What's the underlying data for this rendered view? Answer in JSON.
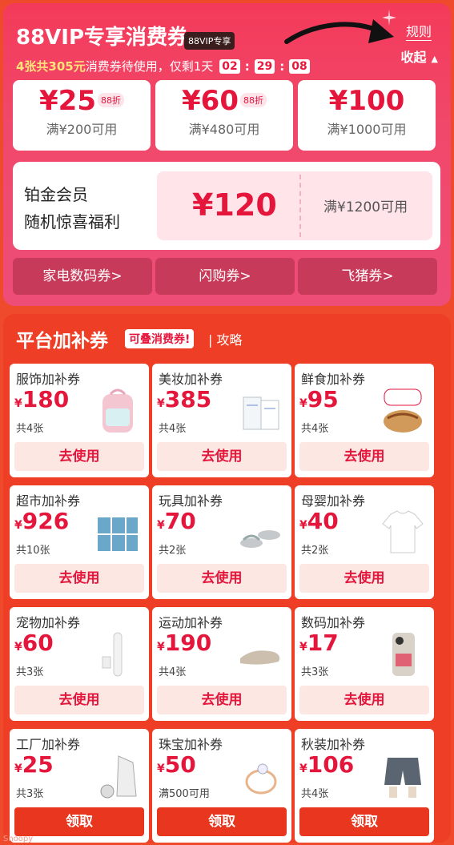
{
  "vip": {
    "title": "88VIP专享消费券",
    "badge": "88VIP专享",
    "rules": "规则",
    "collapse": "收起",
    "countdown_prefix": "4张共305元",
    "countdown_text": "消费券待使用，仅剩1天",
    "timer": [
      "02",
      "29",
      "08"
    ],
    "coupons": [
      {
        "amount": "¥25",
        "discount": "88折",
        "condition": "满¥200可用"
      },
      {
        "amount": "¥60",
        "discount": "88折",
        "condition": "满¥480可用"
      },
      {
        "amount": "¥100",
        "discount": "",
        "condition": "满¥1000可用"
      }
    ],
    "platinum": {
      "line1": "铂金会员",
      "line2": "随机惊喜福利",
      "amount": "¥120",
      "condition": "满¥1200可用"
    },
    "links": [
      "家电数码券>",
      "闪购券>",
      "飞猪券>"
    ]
  },
  "platform": {
    "title": "平台加补券",
    "tag": "可叠消费券!",
    "guide": "| 攻略",
    "cards": [
      {
        "name": "服饰加补券",
        "yen": "¥",
        "value": "180",
        "count": "共4张",
        "button": "去使用",
        "icon": "backpack-icon"
      },
      {
        "name": "美妆加补券",
        "yen": "¥",
        "value": "385",
        "count": "共4张",
        "button": "去使用",
        "icon": "cosmetics-icon"
      },
      {
        "name": "鲜食加补券",
        "yen": "¥",
        "value": "95",
        "count": "共4张",
        "button": "去使用",
        "icon": "noodle-bowl-icon"
      },
      {
        "name": "超市加补券",
        "yen": "¥",
        "value": "926",
        "count": "共10张",
        "button": "去使用",
        "icon": "pet-food-boxes-icon"
      },
      {
        "name": "玩具加补券",
        "yen": "¥",
        "value": "70",
        "count": "共2张",
        "button": "去使用",
        "icon": "sandals-icon"
      },
      {
        "name": "母婴加补券",
        "yen": "¥",
        "value": "40",
        "count": "共2张",
        "button": "去使用",
        "icon": "tshirt-icon"
      },
      {
        "name": "宠物加补券",
        "yen": "¥",
        "value": "60",
        "count": "共3张",
        "button": "去使用",
        "icon": "electric-brush-icon"
      },
      {
        "name": "运动加补券",
        "yen": "¥",
        "value": "190",
        "count": "共4张",
        "button": "去使用",
        "icon": "slipper-icon"
      },
      {
        "name": "数码加补券",
        "yen": "¥",
        "value": "17",
        "count": "共3张",
        "button": "去使用",
        "icon": "phone-case-icon"
      },
      {
        "name": "工厂加补券",
        "yen": "¥",
        "value": "25",
        "count": "共3张",
        "button": "领取",
        "icon": "scooter-jacket-icon"
      },
      {
        "name": "珠宝加补券",
        "yen": "¥",
        "value": "50",
        "count": "满500可用",
        "button": "领取",
        "icon": "ring-icon"
      },
      {
        "name": "秋装加补券",
        "yen": "¥",
        "value": "106",
        "count": "共4张",
        "button": "领取",
        "icon": "shorts-icon"
      }
    ]
  },
  "watermark": "Snoopy",
  "colors": {
    "accent": "#e5163c",
    "panel": "#ee3f26",
    "vip_bg": "#f0486a"
  }
}
